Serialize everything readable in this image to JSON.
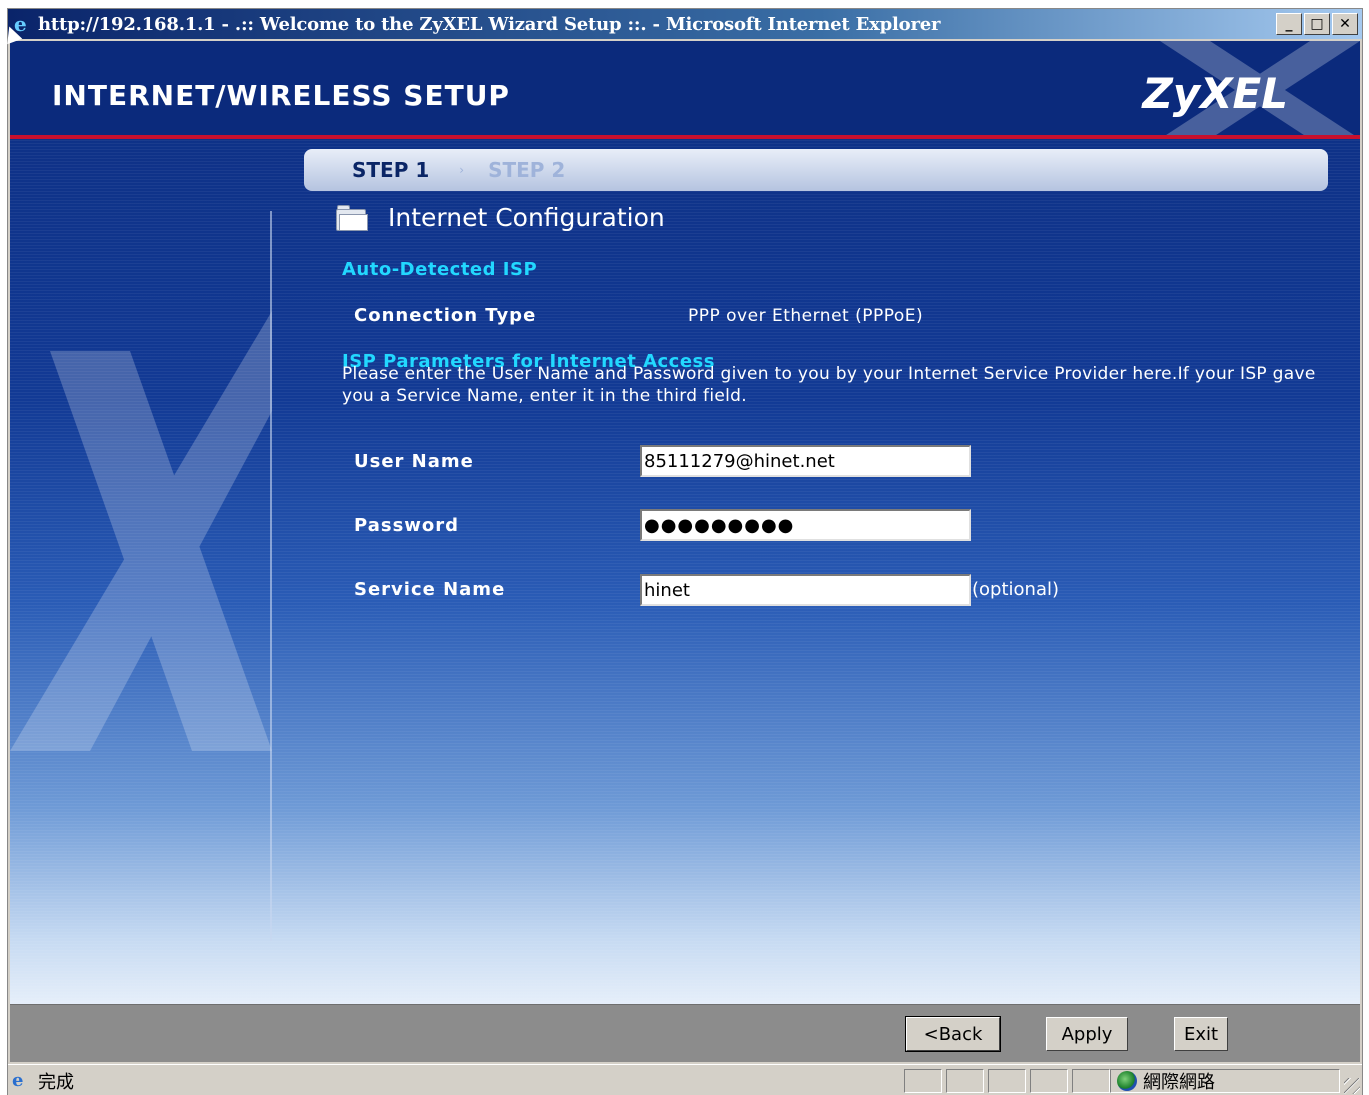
{
  "window": {
    "title": "http://192.168.1.1 - .:: Welcome to the ZyXEL Wizard Setup ::. - Microsoft Internet Explorer",
    "controls": {
      "minimize": "_",
      "maximize": "□",
      "close": "✕"
    }
  },
  "header": {
    "title": "INTERNET/WIRELESS SETUP",
    "logo": "ZyXEL"
  },
  "steps": {
    "step1": "STEP 1",
    "step2": "STEP 2",
    "separator": "›"
  },
  "section": {
    "title": "Internet Configuration",
    "icon": "folder-icon"
  },
  "auto_detected": {
    "heading": "Auto-Detected ISP",
    "connection_type_label": "Connection Type",
    "connection_type_value": "PPP over Ethernet (PPPoE)"
  },
  "isp_params": {
    "heading": "ISP Parameters for Internet Access",
    "description": "Please enter the User Name and Password given to you by your Internet Service Provider here.If your ISP gave you a Service Name, enter it in the third field."
  },
  "form": {
    "user_name_label": "User Name",
    "user_name_value": "85111279@hinet.net",
    "password_label": "Password",
    "password_value": "●●●●●●●●●",
    "service_name_label": "Service Name",
    "service_name_value": "hinet",
    "optional_note": "(optional)"
  },
  "buttons": {
    "back": "<Back",
    "apply": "Apply",
    "exit": "Exit"
  },
  "statusbar": {
    "status": "完成",
    "zone": "網際網路"
  },
  "colors": {
    "header_bg": "#0b2a7c",
    "accent_red": "#c8102e",
    "cyan_heading": "#22d8ff"
  }
}
